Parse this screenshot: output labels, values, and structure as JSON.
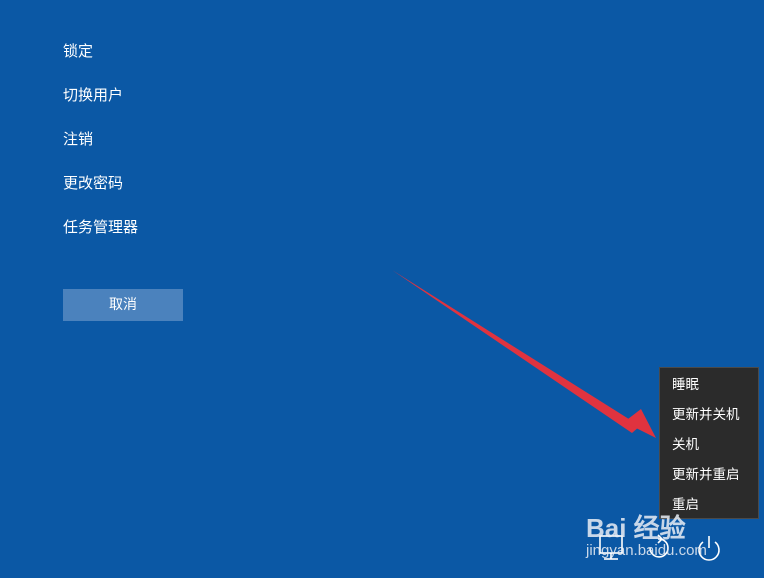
{
  "options_menu": {
    "items": [
      {
        "label": "锁定"
      },
      {
        "label": "切换用户"
      },
      {
        "label": "注销"
      },
      {
        "label": "更改密码"
      },
      {
        "label": "任务管理器"
      }
    ],
    "cancel_label": "取消"
  },
  "power_menu": {
    "items": [
      {
        "label": "睡眠"
      },
      {
        "label": "更新并关机"
      },
      {
        "label": "关机"
      },
      {
        "label": "更新并重启"
      },
      {
        "label": "重启"
      }
    ]
  },
  "tray_icons": [
    "network-icon",
    "accessibility-icon",
    "power-icon"
  ],
  "watermark": {
    "logo_text": "Bai 经验",
    "url_text": "jingyan.baidu.com"
  },
  "colors": {
    "background": "#0b58a5",
    "cancel_button": "#4b82bd",
    "menu_background": "#2b2b2b",
    "arrow": "#e0333f"
  }
}
